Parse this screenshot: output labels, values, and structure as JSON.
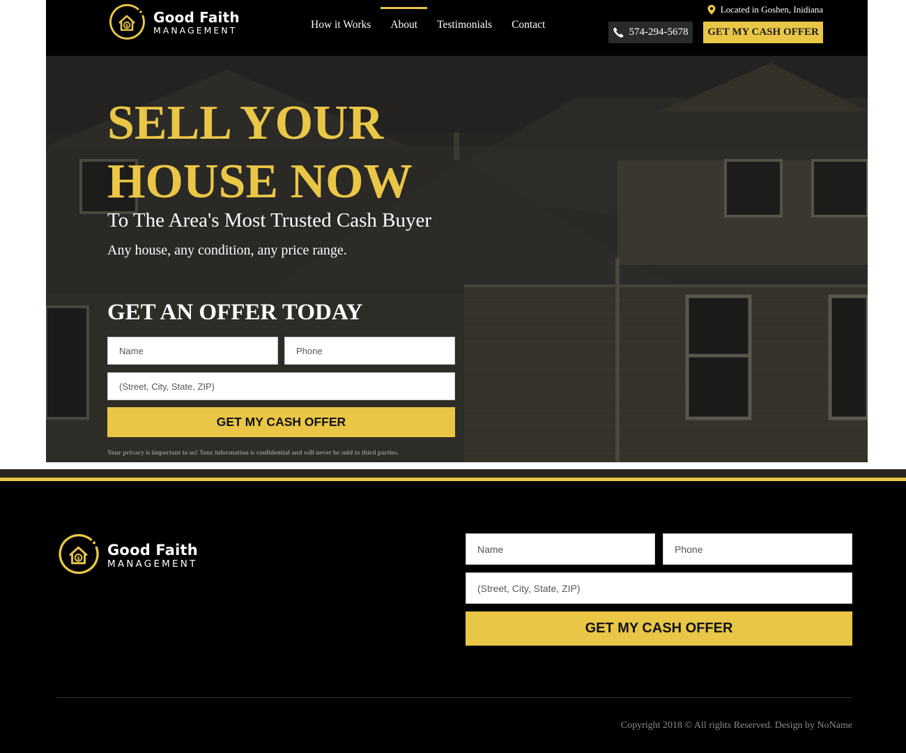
{
  "brand": {
    "name": "Good Faith",
    "subtitle": "MANAGEMENT",
    "accent_color": "#e9c646"
  },
  "header": {
    "nav": [
      {
        "label": "How it Works",
        "active": false
      },
      {
        "label": "About",
        "active": true
      },
      {
        "label": "Testimonials",
        "active": false
      },
      {
        "label": "Contact",
        "active": false
      }
    ],
    "location": "Located in Goshen, Inidiana",
    "phone": "574-294-5678",
    "cta_label": "GET MY CASH OFFER"
  },
  "hero": {
    "title_line1": "SELL YOUR",
    "title_line2": "HOUSE NOW",
    "subtitle": "To The Area's Most Trusted Cash Buyer",
    "tagline": "Any house, any condition, any price range.",
    "form_heading": "GET AN OFFER TODAY",
    "form": {
      "name_placeholder": "Name",
      "phone_placeholder": "Phone",
      "address_placeholder": "(Street, City, State, ZIP)",
      "submit_label": "GET MY CASH OFFER"
    },
    "privacy_note": "Your privacy is important to us! Your information is confidential and will never be sold to third parties."
  },
  "footer": {
    "form": {
      "name_placeholder": "Name",
      "phone_placeholder": "Phone",
      "address_placeholder": "(Street, City, State, ZIP)",
      "submit_label": "GET MY CASH OFFER"
    },
    "copyright": "Copyright 2018 © All rights Reserved. Design by NoName"
  }
}
